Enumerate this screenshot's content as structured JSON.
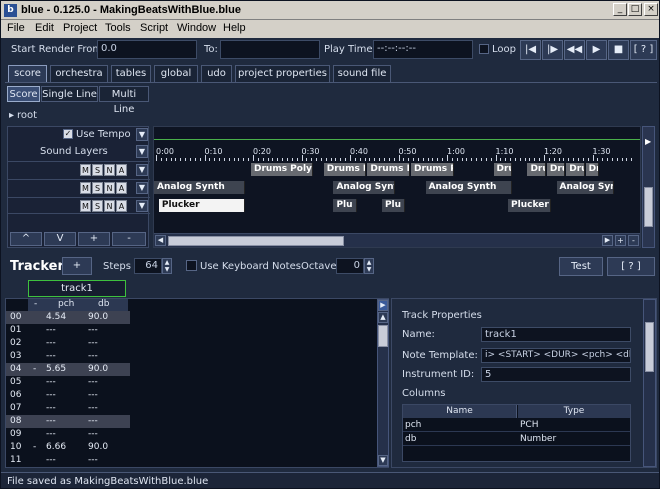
{
  "window": {
    "title": "blue - 0.125.0 - MakingBeatsWithBlue.blue",
    "app_icon": "b"
  },
  "menu": [
    "File",
    "Edit",
    "Project",
    "Tools",
    "Script",
    "Window",
    "Help"
  ],
  "toolbar": {
    "start_render_label": "Start Render From:",
    "start_render_value": "0.0",
    "to_label": "To:",
    "to_value": "",
    "play_time_label": "Play Time:",
    "play_time_value": "--:--:--:--",
    "loop_label": "Loop",
    "help_label": "[ ? ]"
  },
  "tabs": [
    "score",
    "orchestra",
    "tables",
    "global",
    "udo",
    "project properties",
    "sound file"
  ],
  "subtabs": [
    "Score",
    "Single Line",
    "Multi Line"
  ],
  "breadcrumb": "root",
  "layers_panel": {
    "use_tempo_label": "Use Tempo",
    "sound_layers_label": "Sound Layers",
    "layer_buttons": [
      "M",
      "S",
      "N",
      "A"
    ],
    "bottom_buttons": [
      "^",
      "V",
      "+",
      "-"
    ]
  },
  "timeline": {
    "ticks": [
      "0:00",
      "0:10",
      "0:20",
      "0:30",
      "0:40",
      "0:50",
      "1:00",
      "1:10",
      "1:20",
      "1:30"
    ],
    "row1_blocks": [
      {
        "label": "Drums Poly",
        "start": 20,
        "dur": 13
      },
      {
        "label": "Drums Po",
        "start": 35,
        "dur": 9
      },
      {
        "label": "Drums Po",
        "start": 44,
        "dur": 9
      },
      {
        "label": "Drums Po",
        "start": 53,
        "dur": 9
      },
      {
        "label": "Dru",
        "start": 70,
        "dur": 4
      },
      {
        "label": "Drur",
        "start": 77,
        "dur": 4
      },
      {
        "label": "Drur",
        "start": 81,
        "dur": 4
      },
      {
        "label": "Drur",
        "start": 85,
        "dur": 4
      },
      {
        "label": "Dru",
        "start": 89,
        "dur": 3
      }
    ],
    "row2_blocks": [
      {
        "label": "Analog Synth",
        "start": 0,
        "dur": 19
      },
      {
        "label": "Analog Synth",
        "start": 37,
        "dur": 13
      },
      {
        "label": "Analog Synth",
        "start": 56,
        "dur": 18
      },
      {
        "label": "Analog Synth",
        "start": 83,
        "dur": 12
      }
    ],
    "row3_blocks": [
      {
        "label": "Plucker",
        "start": 1,
        "dur": 18
      },
      {
        "label": "Plu",
        "start": 37,
        "dur": 5
      },
      {
        "label": "Plu",
        "start": 47,
        "dur": 5
      },
      {
        "label": "Plucker",
        "start": 73,
        "dur": 9
      }
    ]
  },
  "tracker": {
    "title": "Tracker",
    "add_label": "+",
    "steps_label": "Steps",
    "steps_value": "64",
    "keyboard_notes_label": "Use Keyboard Notes",
    "octave_label": "Octave",
    "octave_value": "0",
    "test_label": "Test",
    "help_label": "[ ? ]",
    "track_name": "track1",
    "columns": [
      "-",
      "pch",
      "db"
    ],
    "rows": [
      {
        "n": "00",
        "x": "",
        "pch": "4.54",
        "db": "90.0",
        "hl": true
      },
      {
        "n": "01",
        "x": "",
        "pch": "---",
        "db": "---",
        "hl": false
      },
      {
        "n": "02",
        "x": "",
        "pch": "---",
        "db": "---",
        "hl": false
      },
      {
        "n": "03",
        "x": "",
        "pch": "---",
        "db": "---",
        "hl": false
      },
      {
        "n": "04",
        "x": "-",
        "pch": "5.65",
        "db": "90.0",
        "hl": true
      },
      {
        "n": "05",
        "x": "",
        "pch": "---",
        "db": "---",
        "hl": false
      },
      {
        "n": "06",
        "x": "",
        "pch": "---",
        "db": "---",
        "hl": false
      },
      {
        "n": "07",
        "x": "",
        "pch": "---",
        "db": "---",
        "hl": false
      },
      {
        "n": "08",
        "x": "",
        "pch": "---",
        "db": "---",
        "hl": true
      },
      {
        "n": "09",
        "x": "",
        "pch": "---",
        "db": "---",
        "hl": false
      },
      {
        "n": "10",
        "x": "-",
        "pch": "6.66",
        "db": "90.0",
        "hl": false
      },
      {
        "n": "11",
        "x": "",
        "pch": "---",
        "db": "---",
        "hl": false
      }
    ]
  },
  "track_properties": {
    "title": "Track Properties",
    "name_label": "Name:",
    "name_value": "track1",
    "note_template_label": "Note Template:",
    "note_template_value": "i> <START> <DUR> <pch> <db>",
    "instrument_label": "Instrument ID:",
    "instrument_value": "5",
    "columns_label": "Columns",
    "table_headers": [
      "Name",
      "Type"
    ],
    "table_rows": [
      [
        "pch",
        "PCH"
      ],
      [
        "db",
        "Number"
      ]
    ]
  },
  "status": "File saved as MakingBeatsWithBlue.blue"
}
